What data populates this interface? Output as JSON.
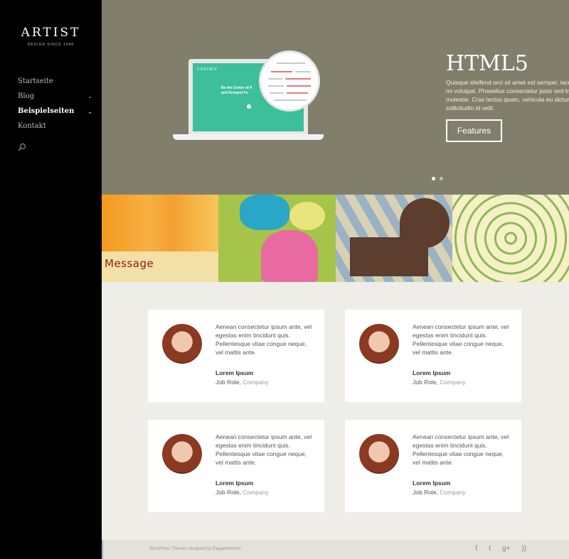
{
  "brand": {
    "title": "ARTIST",
    "subtitle": "DESIGN SINCE 1946"
  },
  "nav": [
    {
      "label": "Startseite"
    },
    {
      "label": "Blog",
      "chevron": "⌄"
    },
    {
      "label": "Beispielseiten",
      "chevron": "⌄"
    },
    {
      "label": "Kontakt"
    }
  ],
  "hero": {
    "screen_logo": "CENTRIC",
    "screen_headline_1": "Be the Center of A",
    "screen_headline_2": "and Demand Fo",
    "title": "HTML5",
    "text": "Quisque eleifend orci sit amet est semper, iaculis tempor mi volutpat. Phasellus consectetur justo sed tristique molestie. Cras lectus quam, vehicula eu dictum a, sollicitudin id velit.",
    "button": "Features",
    "slides_total": 2,
    "slide_active": 1
  },
  "gallery": {
    "message_label": "Message"
  },
  "testimonials": [
    {
      "quote": "Aenean consectetur ipsum ante, vel egestas enim tincidunt quis. Pellentesque vitae congue neque, vel mattis ante.",
      "name": "Lorem Ipsum",
      "role": "Job Role, ",
      "company": "Company"
    },
    {
      "quote": "Aenean consectetur ipsum ante, vel egestas enim tincidunt quis. Pellentesque vitae congue neque, vel mattis ante.",
      "name": "Lorem Ipsum",
      "role": "Job Role, ",
      "company": "Company"
    },
    {
      "quote": "Aenean consectetur ipsum ante, vel egestas enim tincidunt quis. Pellentesque vitae congue neque, vel mattis ante.",
      "name": "Lorem Ipsum",
      "role": "Job Role, ",
      "company": "Company"
    },
    {
      "quote": "Aenean consectetur ipsum ante, vel egestas enim tincidunt quis. Pellentesque vitae congue neque, vel mattis ante.",
      "name": "Lorem Ipsum",
      "role": "Job Role, ",
      "company": "Company"
    }
  ],
  "footer": {
    "credits": "WordPress Themes designed by Elegantthemes",
    "social": [
      {
        "icon": "facebook-icon",
        "glyph": "f"
      },
      {
        "icon": "twitter-icon",
        "glyph": "t"
      },
      {
        "icon": "google-plus-icon",
        "glyph": "g+"
      },
      {
        "icon": "rss-icon",
        "glyph": "))"
      }
    ]
  },
  "colors": {
    "hero_bg": "#827e6c",
    "sidebar_bg": "#000000",
    "content_bg": "#efede8",
    "message": "#8b1c1c"
  }
}
